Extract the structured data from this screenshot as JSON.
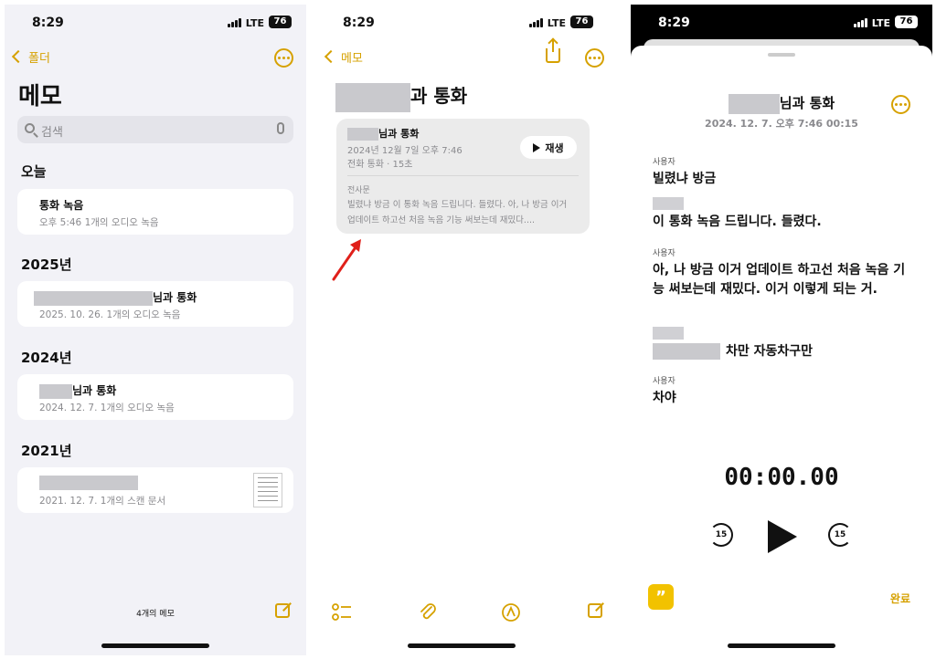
{
  "status": {
    "time": "8:29",
    "network": "LTE",
    "battery": "76"
  },
  "screen1": {
    "back_label": "폴더",
    "title": "메모",
    "search_placeholder": "검색",
    "sections": [
      {
        "heading": "오늘",
        "notes": [
          {
            "title": "통화 녹음",
            "subtitle": "오후 5:46  1개의 오디오 녹음"
          }
        ]
      },
      {
        "heading": "2025년",
        "notes": [
          {
            "title": "님과 통화",
            "subtitle": "2025. 10. 26.  1개의 오디오 녹음"
          }
        ]
      },
      {
        "heading": "2024년",
        "notes": [
          {
            "title": "님과 통화",
            "subtitle": "2024. 12. 7.  1개의 오디오 녹음"
          }
        ]
      },
      {
        "heading": "2021년",
        "notes": [
          {
            "title": "",
            "subtitle": "2021. 12. 7.  1개의 스캔 문서"
          }
        ]
      }
    ],
    "note_count": "4개의 메모"
  },
  "screen2": {
    "back_label": "메모",
    "note_title": "과 통화",
    "card": {
      "title": "님과 통화",
      "date": "2024년 12월 7일 오후 7:46",
      "sub": "전화 통화 · 15초",
      "play_label": "재생",
      "transcript_heading": "전사문",
      "transcript": "빌렸냐 방금 이 통화 녹음 드립니다. 들렸다. 아, 나 방금 이거 업데이트 하고선 처음 녹음 기능 써보는데 재밌다...."
    }
  },
  "screen3": {
    "title": "님과 통화",
    "meta": "2024. 12. 7. 오후 7:46  00:15",
    "transcript": [
      {
        "speaker": "사용자",
        "text": "빌렸냐 방금"
      },
      {
        "speaker": "",
        "text": "이 통화 녹음 드립니다. 들렸다."
      },
      {
        "speaker": "사용자",
        "text": "아, 나 방금 이거 업데이트 하고선 처음 녹음 기능 써보는데 재밌다. 이거 이렇게 되는 거."
      },
      {
        "speaker": "",
        "text": "차만 자동차구만"
      },
      {
        "speaker": "사용자",
        "text": "차야"
      }
    ],
    "timer": "00:00.00",
    "skip_back": "15",
    "skip_forward": "15",
    "done_label": "완료"
  },
  "colors": {
    "accent": "#d6a100",
    "background": "#f2f2f7"
  }
}
